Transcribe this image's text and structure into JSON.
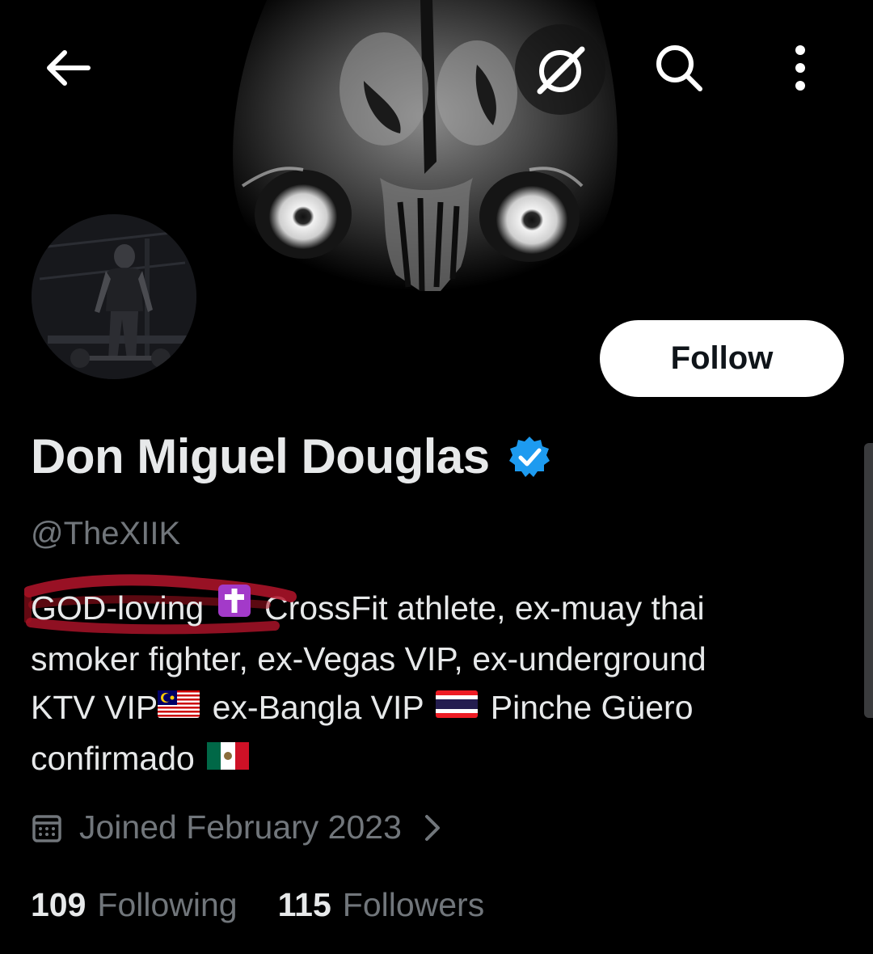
{
  "profile": {
    "display_name": "Don Miguel Douglas",
    "handle": "@TheXIIK",
    "follow_label": "Follow",
    "bio": {
      "highlighted": "GOD-loving",
      "line1_rest": "CrossFit athlete, ex-muay thai",
      "line2": "smoker fighter, ex-Vegas VIP, ex-underground",
      "line3_a": "KTV VIP",
      "line3_b": "ex-Bangla VIP",
      "line3_c": "Pinche Güero",
      "line4": "confirmado"
    },
    "joined": "Joined February 2023",
    "stats": {
      "following_count": "109",
      "following_label": "Following",
      "followers_count": "115",
      "followers_label": "Followers"
    }
  },
  "icons": {
    "back": "back-arrow-icon",
    "grok": "grok-icon",
    "search": "search-icon",
    "more": "more-vertical-icon",
    "verified": "verified-badge-icon",
    "calendar": "calendar-icon",
    "chevron": "chevron-right-icon",
    "bio_emojis": [
      "latin-cross-emoji",
      "malaysia-flag-emoji",
      "thailand-flag-emoji",
      "mexico-flag-emoji"
    ]
  },
  "colors": {
    "background": "#000000",
    "primary_text": "#e7e9ea",
    "secondary_text": "#71767b",
    "verified_blue": "#1d9bf0",
    "annotation_red": "#b3142a"
  }
}
